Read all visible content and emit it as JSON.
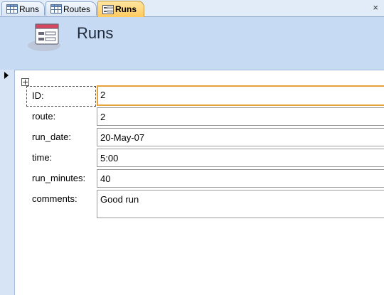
{
  "tabs": [
    {
      "label": "Runs",
      "icon": "table-icon",
      "active": false
    },
    {
      "label": "Routes",
      "icon": "table-icon",
      "active": false
    },
    {
      "label": "Runs",
      "icon": "form-icon",
      "active": true
    }
  ],
  "close_label": "×",
  "header": {
    "title": "Runs",
    "icon": "form-icon"
  },
  "fields": {
    "id": {
      "label": "ID:",
      "value": "2"
    },
    "route": {
      "label": "route:",
      "value": "2"
    },
    "run_date": {
      "label": "run_date:",
      "value": "20-May-07"
    },
    "time": {
      "label": "time:",
      "value": "5:00"
    },
    "run_minutes": {
      "label": "run_minutes:",
      "value": "40"
    },
    "comments": {
      "label": "comments:",
      "value": "Good run"
    }
  },
  "colors": {
    "tab_active": "#ffc95e",
    "header_bg": "#c6daf3",
    "focus_border": "#e7a33b"
  }
}
